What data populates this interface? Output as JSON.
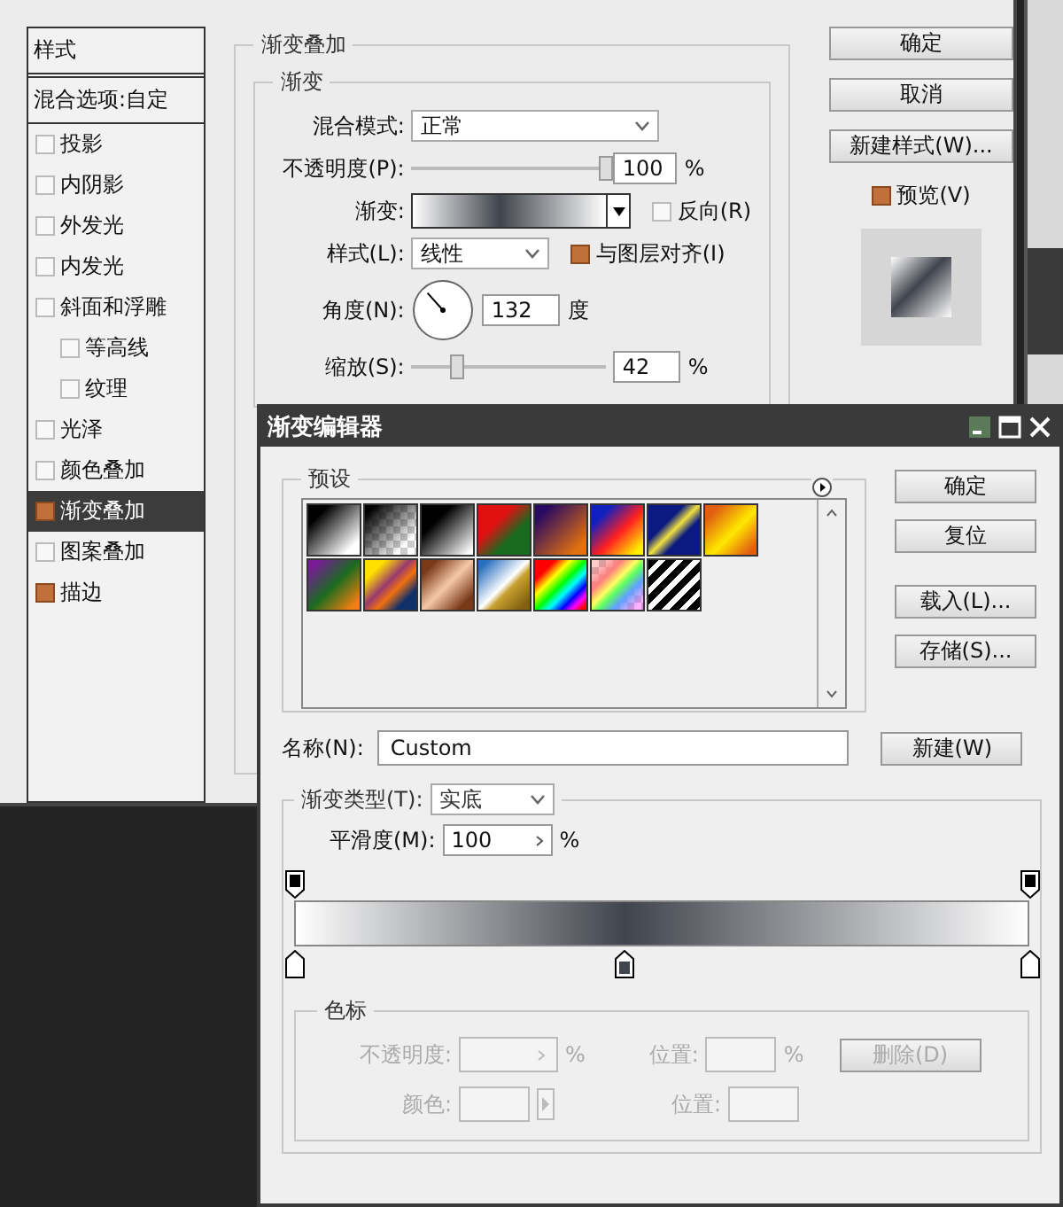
{
  "layer_style": {
    "sidebar": {
      "title": "样式",
      "blending_options": "混合选项:自定",
      "items": [
        {
          "label": "投影",
          "checked": false,
          "selected": false
        },
        {
          "label": "内阴影",
          "checked": false,
          "selected": false
        },
        {
          "label": "外发光",
          "checked": false,
          "selected": false
        },
        {
          "label": "内发光",
          "checked": false,
          "selected": false
        },
        {
          "label": "斜面和浮雕",
          "checked": false,
          "selected": false,
          "children": [
            {
              "label": "等高线",
              "checked": false,
              "selected": false
            },
            {
              "label": "纹理",
              "checked": false,
              "selected": false
            }
          ]
        },
        {
          "label": "光泽",
          "checked": false,
          "selected": false
        },
        {
          "label": "颜色叠加",
          "checked": false,
          "selected": false
        },
        {
          "label": "渐变叠加",
          "checked": true,
          "selected": true
        },
        {
          "label": "图案叠加",
          "checked": false,
          "selected": false
        },
        {
          "label": "描边",
          "checked": true,
          "selected": false
        }
      ]
    },
    "gradient_overlay": {
      "title": "渐变叠加",
      "group_title": "渐变",
      "blend_mode": {
        "label": "混合模式:",
        "value": "正常"
      },
      "opacity": {
        "label": "不透明度(P):",
        "level": 1,
        "value": "100",
        "unit": "%"
      },
      "gradient": {
        "label": "渐变:"
      },
      "reverse": {
        "label": "反向(R)",
        "checked": false
      },
      "style": {
        "label": "样式(L):",
        "value": "线性"
      },
      "align": {
        "label": "与图层对齐(I)",
        "checked": true
      },
      "angle": {
        "label": "角度(N):",
        "value": "132",
        "unit": "度"
      },
      "scale": {
        "label": "缩放(S):",
        "level": 0.23,
        "value": "42",
        "unit": "%"
      }
    },
    "buttons": [
      "确定",
      "取消",
      "新建样式(W)..."
    ],
    "preview": {
      "label": "预览(V)",
      "checked": true
    }
  },
  "gradient_editor": {
    "title": "渐变编辑器",
    "presets": {
      "title": "预设"
    },
    "buttons": [
      "确定",
      "复位",
      "载入(L)...",
      "存储(S)..."
    ],
    "name": {
      "label": "名称(N):",
      "value": "Custom"
    },
    "new_button": "新建(W)",
    "gradient_type": {
      "label": "渐变类型(T):",
      "value": "实底"
    },
    "smoothness": {
      "label": "平滑度(M):",
      "value": "100",
      "unit": "%"
    },
    "opacity_stops": [
      {
        "level": 0
      },
      {
        "level": 1
      }
    ],
    "color_stops": [
      {
        "level": 0,
        "color": "#ffffff"
      },
      {
        "level": 0.45,
        "color": "#40444c"
      },
      {
        "level": 1,
        "color": "#ffffff"
      }
    ],
    "stops_panel": {
      "title": "色标",
      "disabled": true,
      "opacity_label": "不透明度:",
      "opacity_unit": "%",
      "location_label": "位置:",
      "location_unit": "%",
      "delete_button": "删除(D)",
      "color_label": "颜色:",
      "color_location_label": "位置:"
    }
  }
}
